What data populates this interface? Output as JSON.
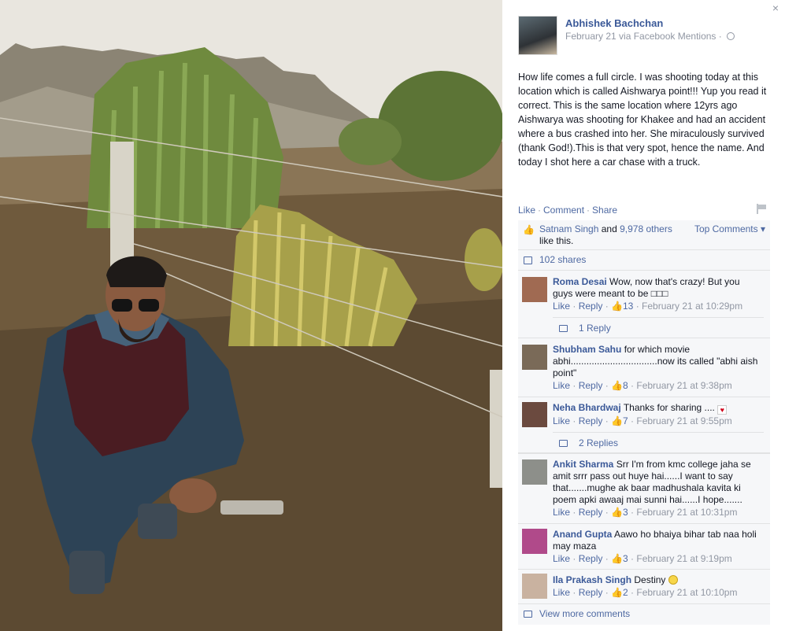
{
  "post": {
    "author": "Abhishek Bachchan",
    "meta": "February 21 via Facebook Mentions ·",
    "text": "How life comes a full circle. I was shooting today at this location which is called Aishwarya point!!! Yup you read it correct. This is the same location where 12yrs ago Aishwarya was shooting for Khakee and had an accident where a bus crashed into her. She miraculously survived (thank God!).This is that very spot, hence the name. And today I shot here a car chase with a truck.",
    "close_glyph": "×"
  },
  "actions": {
    "like": "Like",
    "comment": "Comment",
    "share": "Share",
    "sep": "·"
  },
  "likes": {
    "user": "Satnam Singh",
    "and": "and",
    "others": "9,978 others",
    "suffix": "like this.",
    "top_comments": "Top Comments ▾"
  },
  "shares": "102 shares",
  "comments": [
    {
      "name": "Roma Desai",
      "text": "Wow, now that's crazy! But you guys were meant to be □□□",
      "like": "Like",
      "reply": "Reply",
      "likes": "13",
      "time": "February 21 at 10:29pm",
      "replies": "1 Reply",
      "avatar_color": "#a06a52"
    },
    {
      "name": "Shubham Sahu",
      "text": "for which movie abhi.................................now its called \"abhi aish point\"",
      "like": "Like",
      "reply": "Reply",
      "likes": "8",
      "time": "February 21 at 9:38pm",
      "replies": "",
      "avatar_color": "#7a6a58"
    },
    {
      "name": "Neha Bhardwaj",
      "text": "Thanks for sharing ....",
      "like": "Like",
      "reply": "Reply",
      "likes": "7",
      "time": "February 21 at 9:55pm",
      "replies": "2 Replies",
      "avatar_color": "#6b4a3f"
    },
    {
      "name": "Ankit Sharma",
      "text": "Srr I'm from kmc college jaha se amit srrr pass out huye hai......I want to say that.......mughe ak baar madhushala kavita ki poem apki awaaj mai sunni hai......I hope.......",
      "like": "Like",
      "reply": "Reply",
      "likes": "3",
      "time": "February 21 at 10:31pm",
      "replies": "",
      "avatar_color": "#8d8f8a"
    },
    {
      "name": "Anand Gupta",
      "text": "Aawo ho bhaiya bihar tab naa holi may maza",
      "like": "Like",
      "reply": "Reply",
      "likes": "3",
      "time": "February 21 at 9:19pm",
      "replies": "",
      "avatar_color": "#b04a8a"
    },
    {
      "name": "Ila Prakash Singh",
      "text": "Destiny",
      "like": "Like",
      "reply": "Reply",
      "likes": "2",
      "time": "February 21 at 10:10pm",
      "replies": "",
      "avatar_color": "#c9b2a0"
    }
  ],
  "view_more": "View more comments",
  "icons": {
    "close": "close-icon",
    "globe": "globe-icon",
    "flag": "flag-icon",
    "like_thumb": "thumbs-up-icon",
    "shares": "share-icon",
    "reply": "reply-icon",
    "view_more": "comment-icon"
  },
  "colors": {
    "link": "#4e69a2",
    "name": "#3b5998",
    "meta": "#9197a3",
    "panel": "#f6f7f9"
  }
}
